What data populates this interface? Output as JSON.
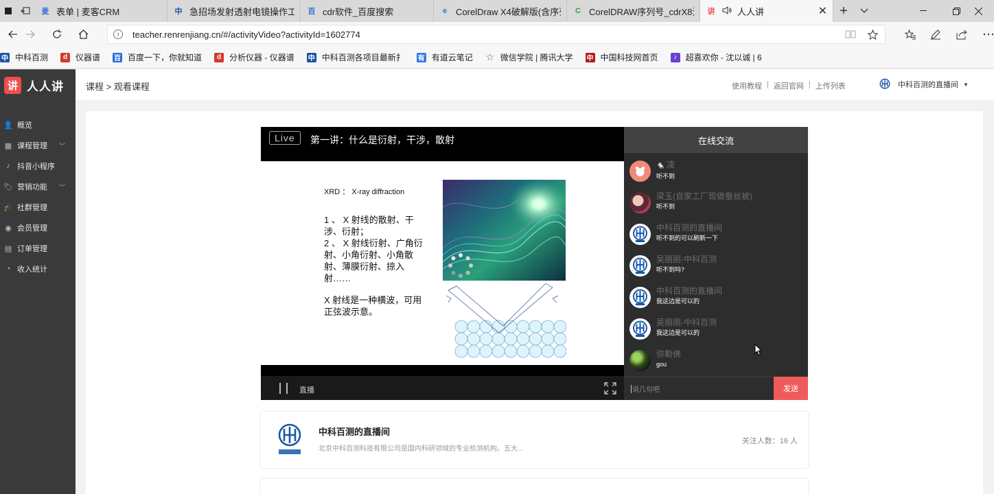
{
  "browser": {
    "tabs": [
      {
        "title": "表单 | 麦客CRM",
        "icon": "maike-icon"
      },
      {
        "title": "急招场发射透射电镜操作工",
        "icon": "zhongke-icon"
      },
      {
        "title": "cdr软件_百度搜索",
        "icon": "baidu-icon"
      },
      {
        "title": "CorelDraw X4破解版(含序列",
        "icon": "edge-icon"
      },
      {
        "title": "CorelDRAW序列号_cdrX8注",
        "icon": "cdr-icon"
      },
      {
        "title": "人人讲",
        "icon": "renrenjiang-icon",
        "active": true
      }
    ],
    "url": "teacher.renrenjiang.cn/#/activityVideo?activityId=1602774",
    "bookmarks": [
      {
        "label": "中科百测",
        "color": "#1a57a8",
        "glyph": "中"
      },
      {
        "label": "仪器谱",
        "color": "#d33b2c",
        "glyph": "d"
      },
      {
        "label": "百度一下，你就知道",
        "color": "#2b6de0",
        "glyph": "百"
      },
      {
        "label": "分析仪器 - 仪器谱",
        "color": "#d33b2c",
        "glyph": "d"
      },
      {
        "label": "中科百测各项目最新扌",
        "color": "#1a57a8",
        "glyph": "中"
      },
      {
        "label": "有道云笔记",
        "color": "#2e7be8",
        "glyph": "有"
      },
      {
        "label": "微信学院 | 腾讯大学",
        "color": "#666666",
        "glyph": "☆"
      },
      {
        "label": "中国科技网首页",
        "color": "#b01c1c",
        "glyph": "中"
      },
      {
        "label": "超喜欢你 - 沈以诚 | 6",
        "color": "#6b3fd6",
        "glyph": "♪"
      }
    ]
  },
  "app": {
    "logo_glyph": "讲",
    "logo_text": "人人讲",
    "menu": [
      {
        "label": "概览",
        "icon": "user-icon",
        "has_caret": false
      },
      {
        "label": "课程管理",
        "icon": "grid-icon",
        "has_caret": true
      },
      {
        "label": "抖音小程序",
        "icon": "tiktok-icon",
        "has_caret": false
      },
      {
        "label": "营销功能",
        "icon": "tag-icon",
        "has_caret": true
      },
      {
        "label": "社群管理",
        "icon": "graduation-icon",
        "has_caret": false
      },
      {
        "label": "会员管理",
        "icon": "member-icon",
        "has_caret": false
      },
      {
        "label": "订单管理",
        "icon": "calendar-icon",
        "has_caret": false
      },
      {
        "label": "收入统计",
        "icon": "pie-icon",
        "has_caret": false
      }
    ],
    "header": {
      "breadcrumb": "课程 > 观看课程",
      "links": [
        "使用教程",
        "返回官网",
        "上传列表"
      ],
      "room_name": "中科百测的直播间"
    }
  },
  "player": {
    "badge": "Live",
    "title": "第一讲：什么是衍射，干涉，散射",
    "slide": {
      "heading": "XRD ： X-ray diffraction",
      "point1": "1 、 X 射线的散射、干涉、衍射；",
      "point2": "2 、 X 射线衍射、广角衍射、小角衍射、小角散射、薄膜衍射、掠入射……",
      "point3": "X 射线是一种横波，可用正弦波示意。"
    },
    "status_label": "直播"
  },
  "chat": {
    "title": "在线交流",
    "messages": [
      {
        "name": "凌",
        "text": "听不到",
        "avatar": "pink",
        "prefix": "🐁 "
      },
      {
        "name": "梁玉(自家工厂现做蚕丝被)",
        "text": "听不到",
        "avatar": "photo",
        "prefix": ""
      },
      {
        "name": "中科百测的直播间",
        "text": "听不到的可以刷新一下",
        "avatar": "logo",
        "prefix": ""
      },
      {
        "name": "吴丽丽-中科百测",
        "text": "听不到吗?",
        "avatar": "logo",
        "prefix": ""
      },
      {
        "name": "中科百测的直播间",
        "text": "我这边是可以的",
        "avatar": "logo",
        "prefix": ""
      },
      {
        "name": "吴丽丽-中科百测",
        "text": "我这边是可以的",
        "avatar": "logo",
        "prefix": ""
      },
      {
        "name": "弥勒佛",
        "text": "gou",
        "avatar": "green",
        "prefix": ""
      }
    ],
    "input_placeholder": "说几句吧",
    "send_label": "发送"
  },
  "room_card": {
    "name": "中科百测的直播间",
    "desc": "北京中科百测科技有限公司是国内科研领域的专业检测机构。五大...",
    "follow_label": "关注人数：16 人"
  },
  "colors": {
    "accent": "#ef5b5b",
    "sidebar": "#3a3a3a",
    "brand_blue": "#1a57a8"
  }
}
